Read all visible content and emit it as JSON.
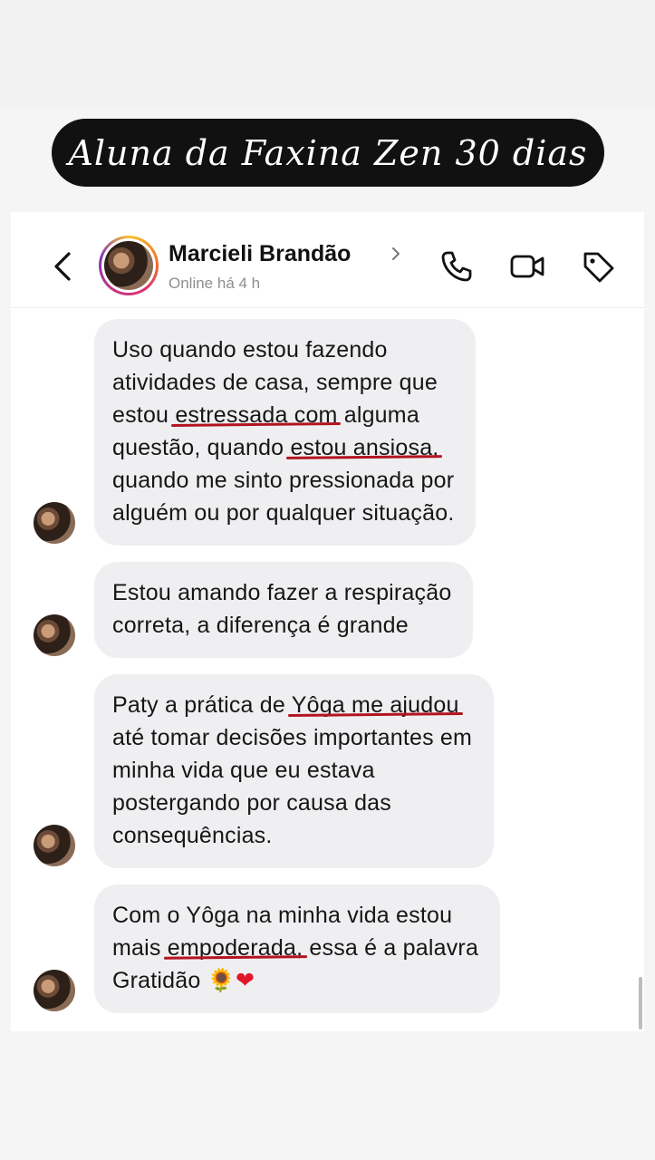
{
  "banner": {
    "title": "Aluna da Faxina Zen 30 dias"
  },
  "header": {
    "contact_name": "Marcieli Brandão",
    "status": "Online há 4 h",
    "icons": [
      "back-icon",
      "chevron-right-icon",
      "phone-icon",
      "video-camera-icon",
      "tag-icon"
    ]
  },
  "messages": [
    {
      "lines": [
        "Uso quando estou fazendo",
        "atividades de casa, sempre que",
        [
          "estou ",
          "estressada com",
          " alguma"
        ],
        [
          "questão, quando ",
          "estou ansiosa,"
        ],
        "quando me sinto pressionada por",
        "alguém ou por qualquer situação."
      ]
    },
    {
      "lines": [
        "Estou amando fazer a respiração",
        "correta, a diferença é grande"
      ]
    },
    {
      "lines": [
        [
          "Paty a prática de ",
          "Yôga me ajudou"
        ],
        "até tomar decisões importantes em",
        "minha vida que eu estava",
        "postergando por causa das",
        "consequências."
      ]
    },
    {
      "lines": [
        "Com o Yôga na minha vida  estou",
        [
          "mais ",
          "empoderada,",
          " essa é a palavra"
        ],
        "Gratidão",
        ""
      ],
      "emojis": [
        "🌻",
        "❤"
      ]
    }
  ],
  "colors": {
    "underline": "#b3141f",
    "bubble": "#efeff1",
    "banner_bg": "#111111"
  }
}
